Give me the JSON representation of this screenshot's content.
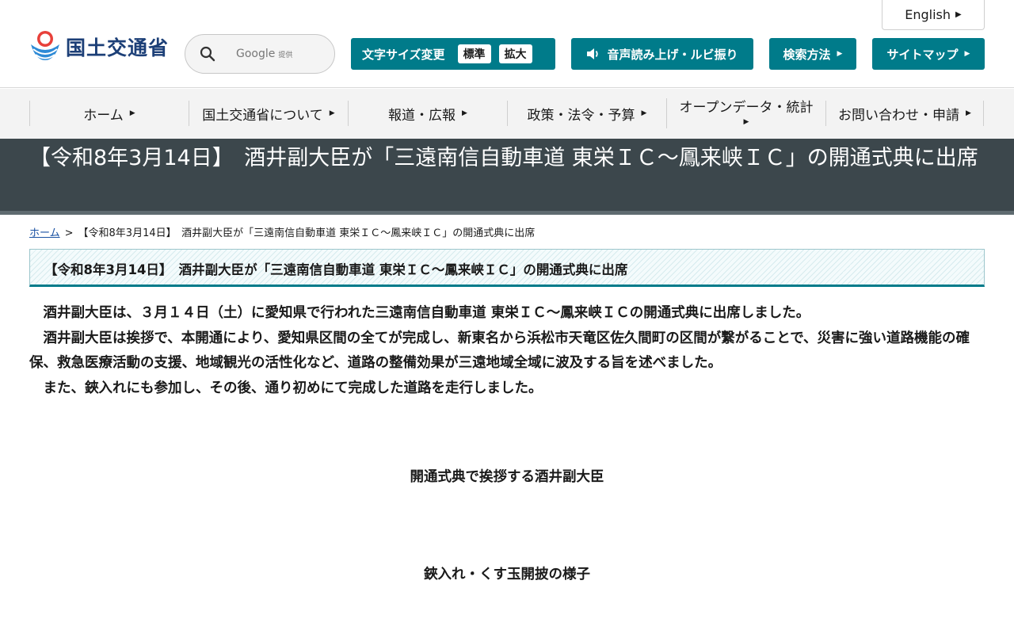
{
  "header": {
    "english_label": "English",
    "logo_text": "国土交通省",
    "search": {
      "brand": "Google",
      "brand_suffix": "提供"
    },
    "font_size": {
      "label": "文字サイズ変更",
      "options": [
        "標準",
        "拡大"
      ]
    },
    "voice_label": "音声読み上げ・ルビ振り",
    "search_method_label": "検索方法",
    "sitemap_label": "サイトマップ",
    "brand_color": "#007b8a"
  },
  "nav": {
    "items": [
      {
        "label": "ホーム"
      },
      {
        "label": "国土交通省について"
      },
      {
        "label": "報道・広報"
      },
      {
        "label": "政策・法令・予算"
      },
      {
        "label": "オープンデータ・統計"
      },
      {
        "label": "お問い合わせ・申請"
      }
    ]
  },
  "page": {
    "title": "【令和8年3月14日】　酒井副大臣が「三遠南信自動車道 東栄ＩＣ～鳳来峡ＩＣ」の開通式典に出席",
    "breadcrumb": {
      "home": "ホーム",
      "separator": ">",
      "current": "【令和8年3月14日】　酒井副大臣が「三遠南信自動車道 東栄ＩＣ～鳳来峡ＩＣ」の開通式典に出席"
    },
    "heading": "【令和8年3月14日】　酒井副大臣が「三遠南信自動車道 東栄ＩＣ～鳳来峡ＩＣ」の開通式典に出席",
    "paragraphs": [
      "酒井副大臣は、３月１４日（土）に愛知県で行われた三遠南信自動車道 東栄ＩＣ～鳳来峡ＩＣの開通式典に出席しました。",
      "酒井副大臣は挨拶で、本開通により、愛知県区間の全てが完成し、新東名から浜松市天竜区佐久間町の区間が繋がることで、災害に強い道路機能の確保、救急医療活動の支援、地域観光の活性化など、道路の整備効果が三遠地域全域に波及する旨を述べました。",
      "また、鋏入れにも参加し、その後、通り初めにて完成した道路を走行しました。"
    ],
    "captions": [
      "開通式典で挨拶する酒井副大臣",
      "鋏入れ・くす玉開披の様子"
    ]
  }
}
